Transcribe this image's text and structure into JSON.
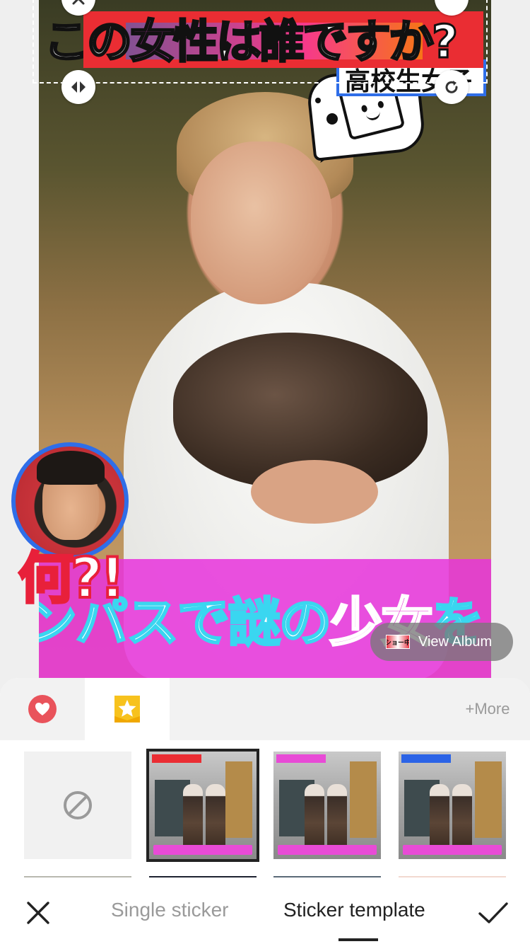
{
  "sticker": {
    "title_part1": "この",
    "title_part2": "女性",
    "title_part3": "は",
    "title_part4": "誰",
    "title_part5": "ですか?",
    "subtitle": "高校生女子",
    "reaction": "何?!",
    "caption_part1": "ンパスで謎の",
    "caption_part2": "少女",
    "caption_part3": "を"
  },
  "view_album": {
    "label": "View Album",
    "thumb_text": "ショー中"
  },
  "category_tabs": [
    {
      "icon": "heart-icon",
      "active": false
    },
    {
      "icon": "star-icon",
      "active": true
    }
  ],
  "more_label": "+More",
  "templates": [
    {
      "kind": "none"
    },
    {
      "kind": "template",
      "selected": true
    },
    {
      "kind": "template",
      "selected": false
    },
    {
      "kind": "template",
      "selected": false
    }
  ],
  "bottom_nav": {
    "single_sticker": "Single sticker",
    "sticker_template": "Sticker template"
  },
  "colors": {
    "accent_red": "#ea2d33",
    "accent_pink": "#e84bd6",
    "accent_blue": "#2b63e6",
    "heart_red": "#e9535b",
    "star_yellow": "#f7c21d"
  }
}
